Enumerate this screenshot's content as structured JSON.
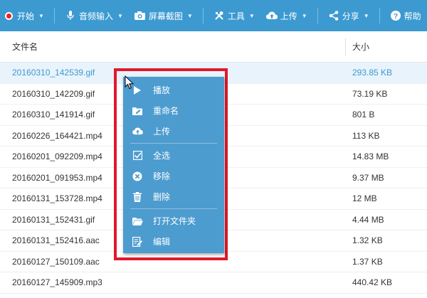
{
  "toolbar": {
    "start": "开始",
    "audio": "音频输入",
    "screenshot": "屏幕截图",
    "tools": "工具",
    "upload": "上传",
    "share": "分享",
    "help": "帮助"
  },
  "table": {
    "col_name": "文件名",
    "col_size": "大小",
    "rows": [
      {
        "name": "20160310_142539.gif",
        "size": "293.85 KB",
        "selected": true
      },
      {
        "name": "20160310_142209.gif",
        "size": "73.19 KB"
      },
      {
        "name": "20160310_141914.gif",
        "size": "801 B"
      },
      {
        "name": "20160226_164421.mp4",
        "size": "113 KB"
      },
      {
        "name": "20160201_092209.mp4",
        "size": "14.83 MB"
      },
      {
        "name": "20160201_091953.mp4",
        "size": "9.37 MB"
      },
      {
        "name": "20160131_153728.mp4",
        "size": "12 MB"
      },
      {
        "name": "20160131_152431.gif",
        "size": "4.44 MB"
      },
      {
        "name": "20160131_152416.aac",
        "size": "1.32 KB"
      },
      {
        "name": "20160127_150109.aac",
        "size": "1.37 KB"
      },
      {
        "name": "20160127_145909.mp3",
        "size": "440.42 KB"
      }
    ]
  },
  "context_menu": {
    "play": "播放",
    "rename": "重命名",
    "upload": "上传",
    "select_all": "全选",
    "remove": "移除",
    "delete": "删除",
    "open_folder": "打开文件夹",
    "edit": "编辑"
  },
  "colors": {
    "toolbar_bg": "#3c9ad1",
    "menu_bg": "#4d9ccf",
    "highlight_border": "#e0192b",
    "selected_text": "#3c9ad1"
  }
}
